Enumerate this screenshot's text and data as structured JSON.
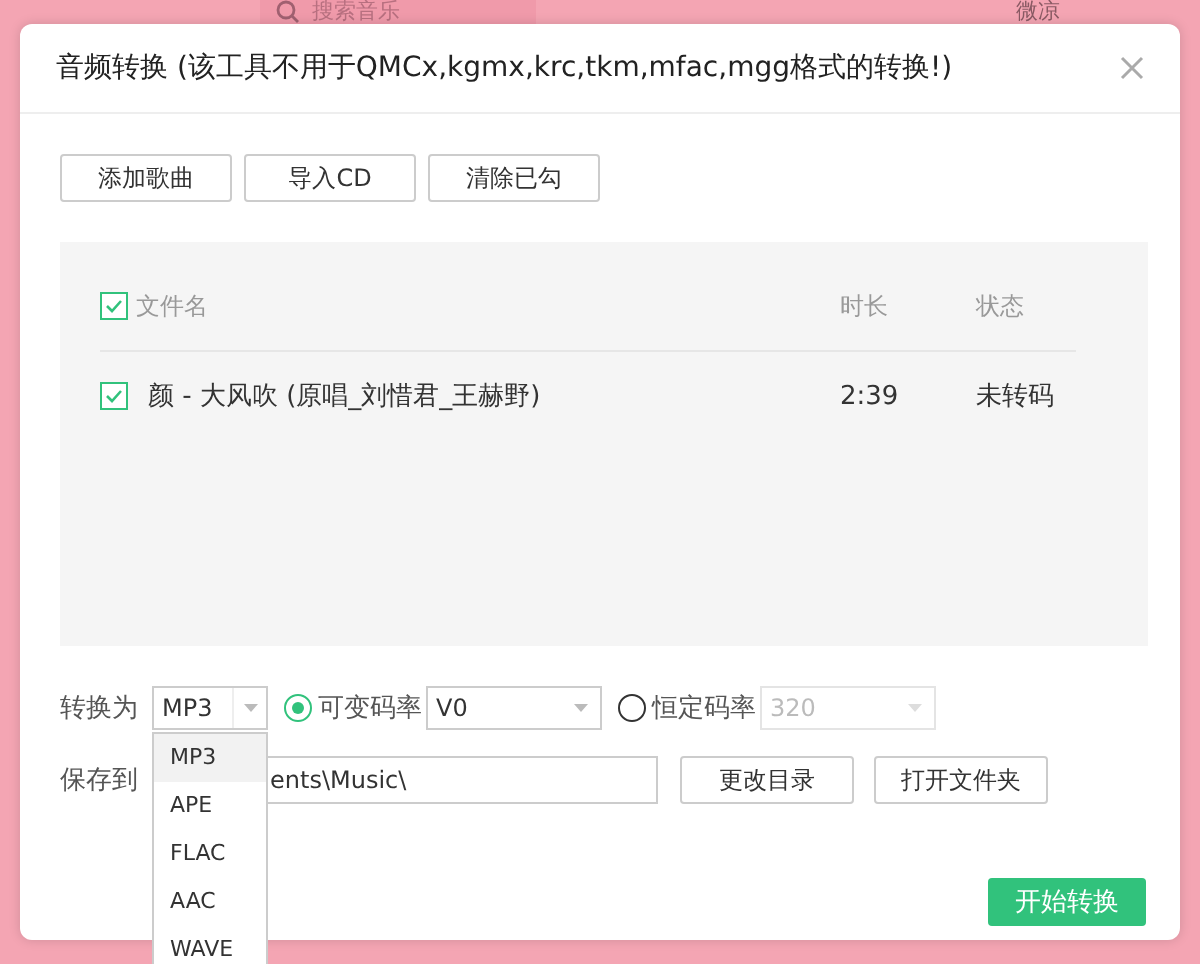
{
  "background_app": {
    "search": {
      "placeholder": "搜索音乐"
    },
    "user_name": "微凉"
  },
  "dialog": {
    "title": "音频转换 (该工具不用于QMCx,kgmx,krc,tkm,mfac,mgg格式的转换!)",
    "toolbar": [
      "添加歌曲",
      "导入CD",
      "清除已勾"
    ],
    "table": {
      "columns": [
        {
          "label": "文件名",
          "checked": true
        },
        {
          "label": "时长"
        },
        {
          "label": "状态"
        }
      ],
      "rows": [
        {
          "checked": true,
          "name": "颜 - 大风吹 (原唱_刘惜君_王赫野)",
          "duration": "2:39",
          "status": "未转码"
        }
      ]
    },
    "format": {
      "label": "转换为",
      "value": "MP3",
      "expanded": true,
      "options": [
        {
          "label": "MP3",
          "selected": true
        },
        {
          "label": "APE",
          "selected": false
        },
        {
          "label": "FLAC",
          "selected": false
        },
        {
          "label": "AAC",
          "selected": false
        },
        {
          "label": "WAVE",
          "selected": false
        }
      ]
    },
    "bitrate_modes": [
      {
        "label": "可变码率",
        "selected": true,
        "value": "V0",
        "disabled": false
      },
      {
        "label": "恒定码率",
        "selected": false,
        "value": "320",
        "disabled": true
      }
    ],
    "save": {
      "label": "保存到",
      "path": "ents\\Music\\",
      "buttons": [
        "更改目录",
        "打开文件夹"
      ]
    },
    "start_button": "开始转换"
  }
}
